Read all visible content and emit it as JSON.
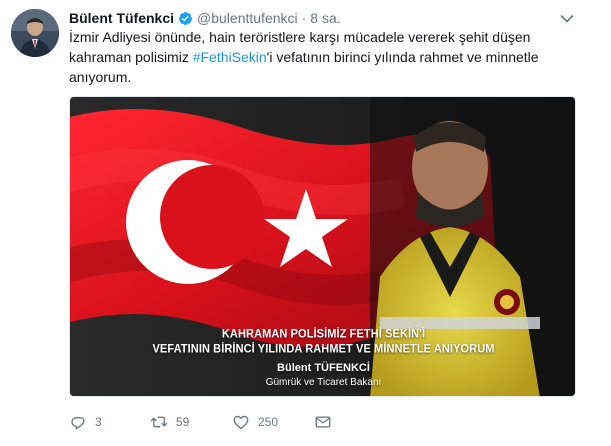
{
  "tweet": {
    "author_name": "Bülent Tüfenkci",
    "handle": "@bulenttufenkci",
    "separator": "·",
    "time": "8 sa.",
    "text_before": "İzmir Adliyesi önünde, hain teröristlere karşı mücadele vererek şehit düşen kahraman polisimiz ",
    "hashtag": "#FethiSekin",
    "text_after": "'i vefatının birinci yılında rahmet ve minnetle anıyorum.",
    "verified": true
  },
  "media": {
    "caption_line1": "KAHRAMAN POLİSİMİZ FETHİ SEKİN'İ",
    "caption_line2": "VEFATININ BİRİNCİ YILINDA RAHMET VE MİNNETLE ANIYORUM",
    "signature_name": "Bülent TÜFENKCİ",
    "signature_title": "Gümrük ve Ticaret Bakanı",
    "flag_color": "#d8111b"
  },
  "actions": {
    "reply_count": "3",
    "retweet_count": "59",
    "like_count": "250",
    "icons": [
      "reply-icon",
      "retweet-icon",
      "like-icon",
      "direct-message-icon"
    ]
  },
  "colors": {
    "text": "#14171a",
    "secondary": "#657786",
    "link": "#1b95e0",
    "verified": "#1da1f2"
  }
}
